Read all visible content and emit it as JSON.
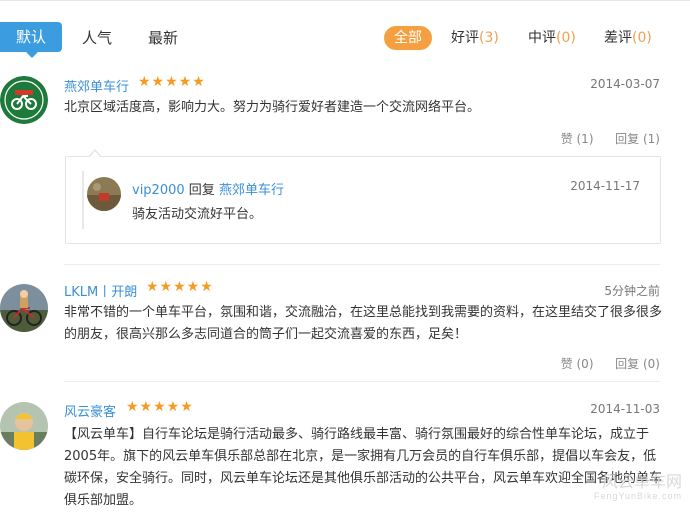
{
  "tabs": {
    "items": [
      "默认",
      "人气",
      "最新"
    ],
    "active": "默认"
  },
  "filters": {
    "all": "全部",
    "good": {
      "label": "好评",
      "count": "(3)"
    },
    "mid": {
      "label": "中评",
      "count": "(0)"
    },
    "bad": {
      "label": "差评",
      "count": "(0)"
    }
  },
  "comments": [
    {
      "user": "燕郊单车行",
      "stars": "★★★★★",
      "date": "2014-03-07",
      "text": "北京区域活度高，影响力大。努力为骑行爱好者建造一个交流网络平台。",
      "like": "赞 (1)",
      "reply": "回复 (1)",
      "replies": [
        {
          "user": "vip2000",
          "verb": "回复",
          "target": "燕郊单车行",
          "date": "2014-11-17",
          "text": "骑友活动交流好平台。"
        }
      ]
    },
    {
      "user": "LKLM丨开朗",
      "stars": "★★★★★",
      "date": "5分钟之前",
      "text": "非常不错的一个单车平台，氛围和谐，交流融洽，在这里总能找到我需要的资料，在这里结交了很多很多的朋友，很高兴那么多志同道合的筒子们一起交流喜爱的东西，足矣！",
      "like": "赞 (0)",
      "reply": "回复 (0)"
    },
    {
      "user": "风云豪客",
      "stars": "★★★★★",
      "date": "2014-11-03",
      "text": "【风云单车】自行车论坛是骑行活动最多、骑行路线最丰富、骑行氛围最好的综合性单车论坛，成立于2005年。旗下的风云单车俱乐部总部在北京，是一家拥有几万会员的自行车俱乐部，提倡以车会友，低碳环保，安全骑行。同时，风云单车论坛还是其他俱乐部活动的公共平台，风云单车欢迎全国各地的单车俱乐部加盟。"
    }
  ],
  "watermark": {
    "line1": "风云单车网",
    "line2": "FengYunBike.com"
  },
  "colors": {
    "accent": "#3b9de0",
    "orange": "#f5a040",
    "star": "#f59b23",
    "link": "#3a8fd6"
  }
}
